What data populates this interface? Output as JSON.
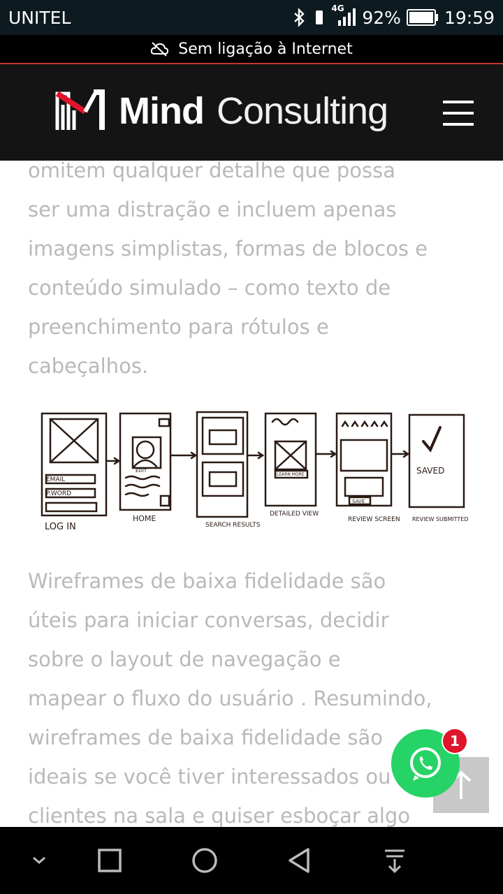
{
  "status_bar": {
    "carrier": "UNITEL",
    "network": "4G",
    "battery": "92%",
    "time": "19:59",
    "icons": [
      "bluetooth-icon",
      "signal-icon",
      "battery-icon"
    ]
  },
  "offline_banner": {
    "icon": "cloud-off-icon",
    "text": "Sem ligação à Internet"
  },
  "header": {
    "logo_word1": "Mind",
    "logo_word2": "Consulting",
    "menu_icon": "hamburger-icon",
    "accent": "#e0142a"
  },
  "article": {
    "paragraph1_lines": [
      "omitem qualquer detalhe que possa",
      "ser uma distração e incluem apenas",
      "imagens simplistas, formas de blocos e",
      "conteúdo simulado – como texto de",
      "preenchimento para rótulos e",
      "cabeçalhos."
    ],
    "sketch_labels": {
      "login": "LOG IN",
      "email": "EMAIL",
      "pword": "P.WORD",
      "home": "HOME",
      "edit": "EDIT",
      "search_results": "SEARCH RESULTS",
      "detailed_view": "DETAILED VIEW",
      "learn_more": "LEARN MORE",
      "review_screen": "REVIEW SCREEN",
      "save": "SAVE",
      "review_submitted": "REVIEW SUBMITTED",
      "saved": "SAVED"
    },
    "paragraph2_lines": [
      "Wireframes de baixa fidelidade são",
      "úteis para iniciar conversas, decidir",
      "sobre o layout de navegação e",
      "mapear o fluxo do usuário . Resumindo,",
      "wireframes de baixa fidelidade são",
      "ideais se você tiver interessados ou",
      "clientes na sala e quiser esboçar algo"
    ]
  },
  "floating": {
    "whatsapp_badge": "1",
    "whatsapp_color": "#25d366",
    "scroll_top_icon": "arrow-up-icon"
  },
  "nav_bar": {
    "icons": [
      "chevron-down-icon",
      "recents-icon",
      "home-icon",
      "back-icon",
      "notification-pull-icon"
    ]
  }
}
